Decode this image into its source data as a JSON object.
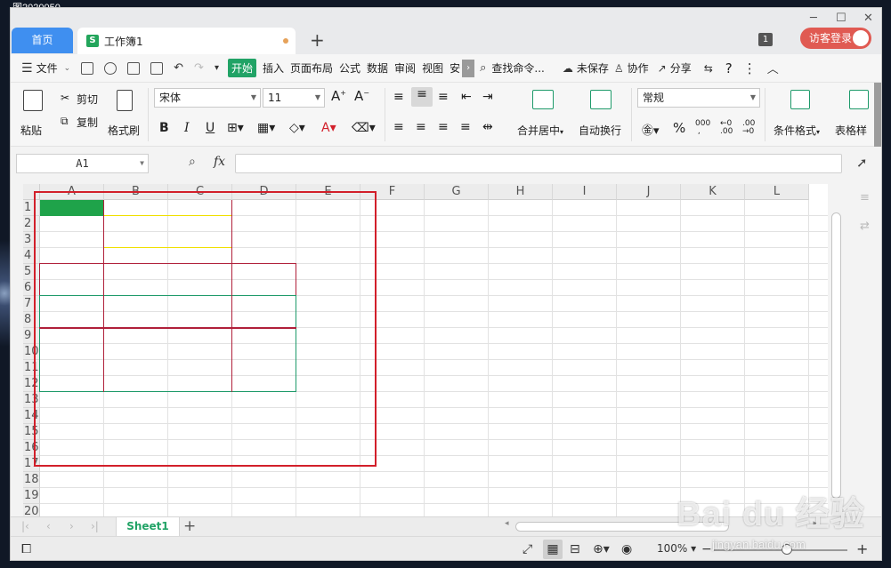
{
  "desktop": {
    "label": "图2020050"
  },
  "tabs": {
    "home": "首页",
    "document": "工作簿1",
    "add": "+"
  },
  "window_controls": {
    "minimize": "─",
    "restore": "☐",
    "close": "✕"
  },
  "account": {
    "badge": "1",
    "login": "访客登录"
  },
  "menu": {
    "file": "文件",
    "items": [
      "开始",
      "插入",
      "页面布局",
      "公式",
      "数据",
      "审阅",
      "视图",
      "安"
    ],
    "search": "查找命令...",
    "unsaved": "未保存",
    "collab": "协作",
    "share": "分享",
    "help": "?",
    "more": "⋮"
  },
  "ribbon": {
    "paste": "粘贴",
    "cut": "剪切",
    "copy": "复制",
    "format_painter": "格式刷",
    "font_name": "宋体",
    "font_size": "11",
    "bold": "B",
    "italic": "I",
    "underline": "U",
    "merge_center": "合并居中",
    "wrap_text": "自动换行",
    "number_format": "常规",
    "conditional_format": "条件格式",
    "table_style": "表格样"
  },
  "formula_bar": {
    "name_box": "A1",
    "fx": "fx",
    "formula": ""
  },
  "sheet": {
    "columns": [
      "A",
      "B",
      "C",
      "D",
      "E",
      "F",
      "G",
      "H",
      "I",
      "J",
      "K",
      "L"
    ],
    "rows": [
      "1",
      "2",
      "3",
      "4",
      "5",
      "6",
      "7",
      "8",
      "9",
      "10",
      "11",
      "12",
      "13",
      "14",
      "15",
      "16",
      "17",
      "18",
      "19",
      "20"
    ],
    "selected_cell": "A1",
    "colors": {
      "selection": "#1fa34a",
      "outer_border": "#d21f2a",
      "yellow_border": "#f0e000",
      "dark_red_border": "#b0203a",
      "green_border": "#1e9a6a"
    }
  },
  "sheet_tabs": {
    "active": "Sheet1",
    "add": "+"
  },
  "status": {
    "zoom": "100%",
    "zoom_in": "+",
    "zoom_out": "−"
  },
  "watermark": {
    "brand": "Baidu经验",
    "url": "jingyan.baidu.com"
  }
}
